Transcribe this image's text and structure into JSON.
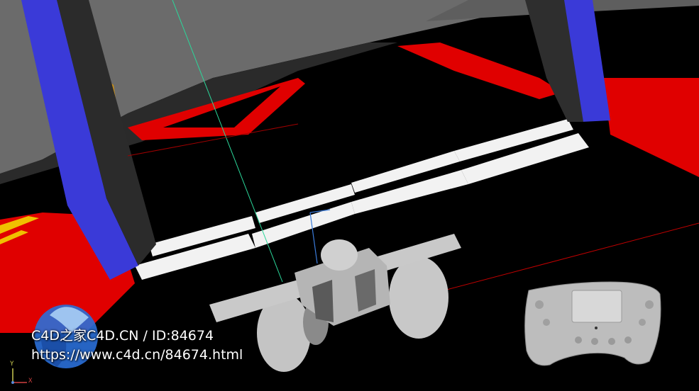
{
  "watermark": {
    "line1": "C4D之家C4D.CN / ID:84674",
    "line2": "https://www.c4d.cn/84674.html"
  },
  "axes": {
    "y_label": "Y",
    "x_label": "X"
  },
  "icons": [
    "c4d-logo-icon",
    "axis-gizmo-icon",
    "steering-wheel-icon"
  ],
  "colors": {
    "background": "#000000",
    "track_red": "#e00000",
    "gantry_blue": "#3a3ad0",
    "ceiling_gray": "#6a6a6a",
    "model_gray": "#bdbdbd",
    "guide_green": "#2bd79a",
    "guide_red": "#c00000"
  }
}
